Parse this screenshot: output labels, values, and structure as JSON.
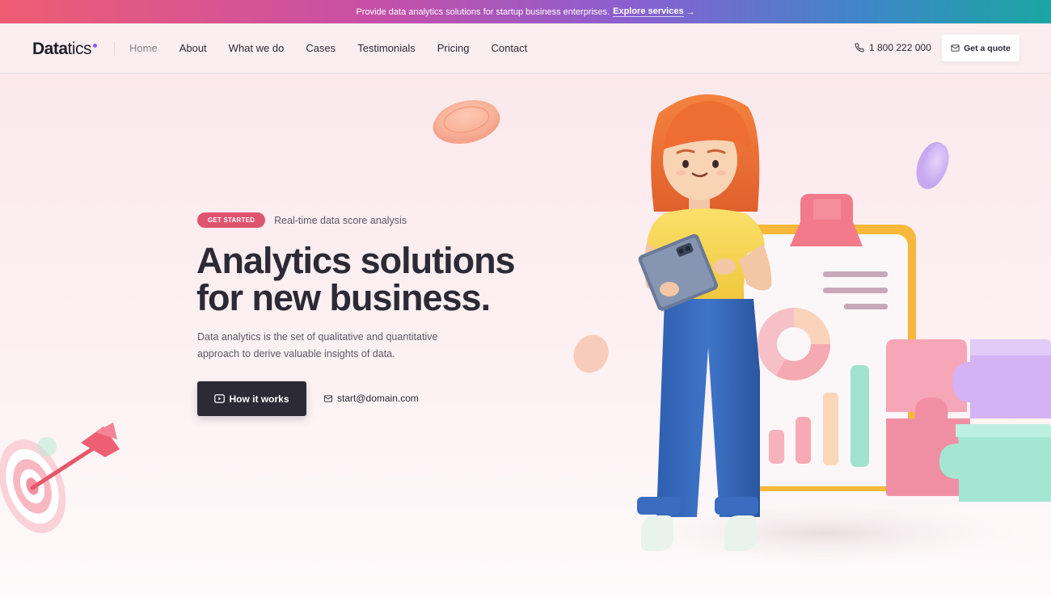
{
  "promo": {
    "text": "Provide data analytics solutions for startup business enterprises.",
    "link_label": "Explore services",
    "arrow_icon": "arrow-right-icon"
  },
  "header": {
    "logo_bold": "Data",
    "logo_light": "tics",
    "nav": [
      {
        "label": "Home",
        "active": true
      },
      {
        "label": "About"
      },
      {
        "label": "What we do"
      },
      {
        "label": "Cases"
      },
      {
        "label": "Testimonials"
      },
      {
        "label": "Pricing"
      },
      {
        "label": "Contact"
      }
    ],
    "phone": "1 800 222 000",
    "phone_icon": "phone-icon",
    "quote_label": "Get a quote",
    "quote_icon": "mail-icon"
  },
  "hero": {
    "badge": "GET STARTED",
    "badge_text": "Real-time data score analysis",
    "headline_line1": "Analytics solutions",
    "headline_line2_prefix": "for new ",
    "headline_line2_highlight": "business.",
    "description": "Data analytics is the set of qualitative and quantitative approach to derive valuable insights of data.",
    "cta_label": "How it works",
    "cta_icon": "play-icon",
    "email": "start@domain.com",
    "email_icon": "mail-icon"
  },
  "colors": {
    "accent": "#e0536e",
    "dark": "#2b2a35",
    "background": "#fbeef0"
  }
}
